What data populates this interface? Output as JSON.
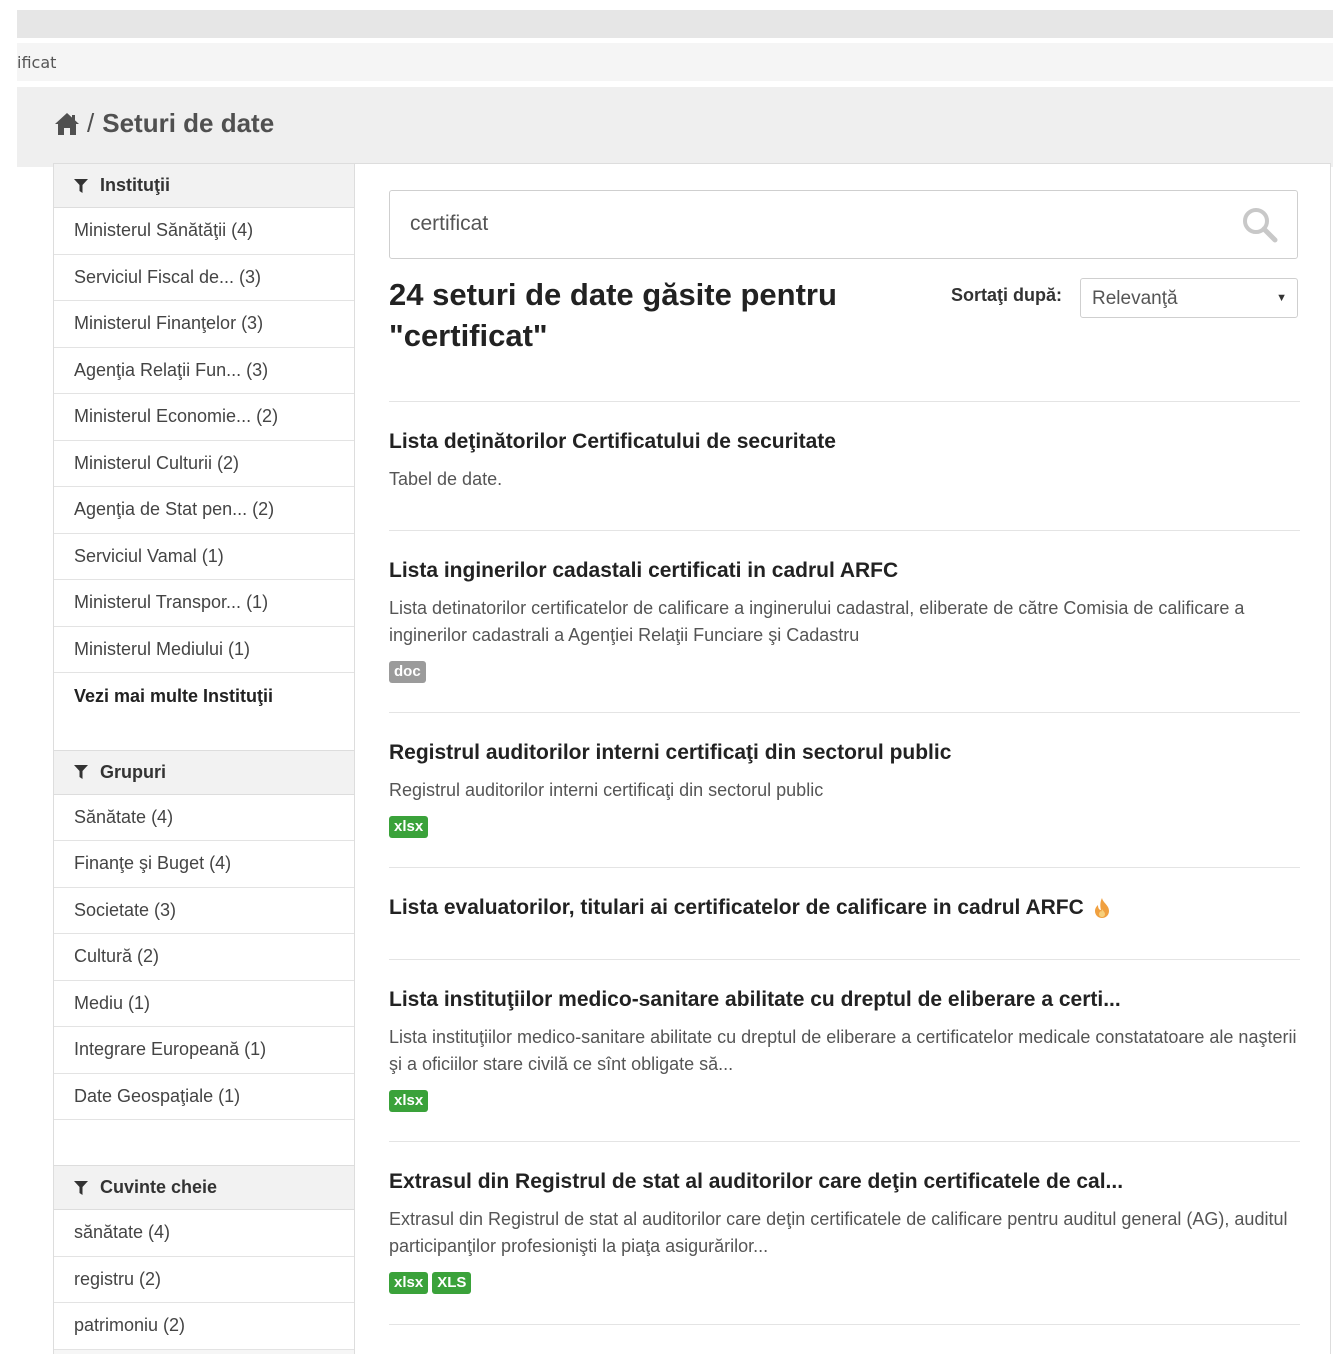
{
  "browser": {
    "url_fragment": "ificat"
  },
  "breadcrumb": {
    "separator": "/",
    "title": "Seturi de date"
  },
  "sidebar": {
    "institutions": {
      "heading": "Instituţii",
      "items": [
        "Ministerul Sănătăţii (4)",
        "Serviciul Fiscal de... (3)",
        "Ministerul Finanţelor (3)",
        "Agenţia Relaţii Fun... (3)",
        "Ministerul Economie... (2)",
        "Ministerul Culturii (2)",
        "Agenţia de Stat pen... (2)",
        "Serviciul Vamal (1)",
        "Ministerul Transpor... (1)",
        "Ministerul Mediului (1)"
      ],
      "more": "Vezi mai multe Instituţii"
    },
    "groups": {
      "heading": "Grupuri",
      "items": [
        "Sănătate (4)",
        "Finanţe şi Buget (4)",
        "Societate (3)",
        "Cultură (2)",
        "Mediu (1)",
        "Integrare Europeană (1)",
        "Date Geospaţiale (1)"
      ]
    },
    "keywords": {
      "heading": "Cuvinte cheie",
      "items": [
        "sănătate (4)",
        "registru (2)",
        "patrimoniu (2)"
      ]
    }
  },
  "search": {
    "value": "certificat"
  },
  "results_header": {
    "count_text": "24 seturi de date găsite pentru \"certificat\"",
    "sort_label": "Sortaţi după:",
    "sort_value": "Relevanţă"
  },
  "results": [
    {
      "title": "Lista deţinătorilor Certificatului de securitate",
      "description": "Tabel de date.",
      "formats": []
    },
    {
      "title": "Lista inginerilor cadastali certificati in cadrul ARFC",
      "description": "Lista detinatorilor certificatelor de calificare a inginerului cadastral, eliberate de către Comisia de calificare a inginerilor cadastrali a Agenţiei Relaţii Funciare şi Cadastru",
      "formats": [
        "doc"
      ]
    },
    {
      "title": "Registrul auditorilor interni certificaţi din sectorul public",
      "description": "Registrul auditorilor interni certificaţi din sectorul public",
      "formats": [
        "xlsx"
      ]
    },
    {
      "title": "Lista evaluatorilor, titulari ai certificatelor de calificare in cadrul ARFC",
      "description": "",
      "formats": [],
      "popular_icon": "flame-icon"
    },
    {
      "title": "Lista instituţiilor medico-sanitare abilitate cu dreptul de eliberare a certi...",
      "description": "Lista instituţiilor medico-sanitare abilitate cu dreptul de eliberare a certificatelor medicale constatatoare ale naşterii şi a oficiilor stare civilă ce sînt obligate să...",
      "formats": [
        "xlsx"
      ]
    },
    {
      "title": "Extrasul din Registrul de stat al auditorilor care deţin certificatele de cal...",
      "description": "Extrasul din Registrul de stat al auditorilor care deţin certificatele de calificare pentru auditul general (AG), auditul participanţilor profesionişti la piaţa asigurărilor...",
      "formats": [
        "xlsx",
        "XLS"
      ]
    }
  ],
  "colors": {
    "badge_doc": "#9b9b9b",
    "badge_xlsx": "#3aa23a",
    "flame": "#f0a040"
  }
}
